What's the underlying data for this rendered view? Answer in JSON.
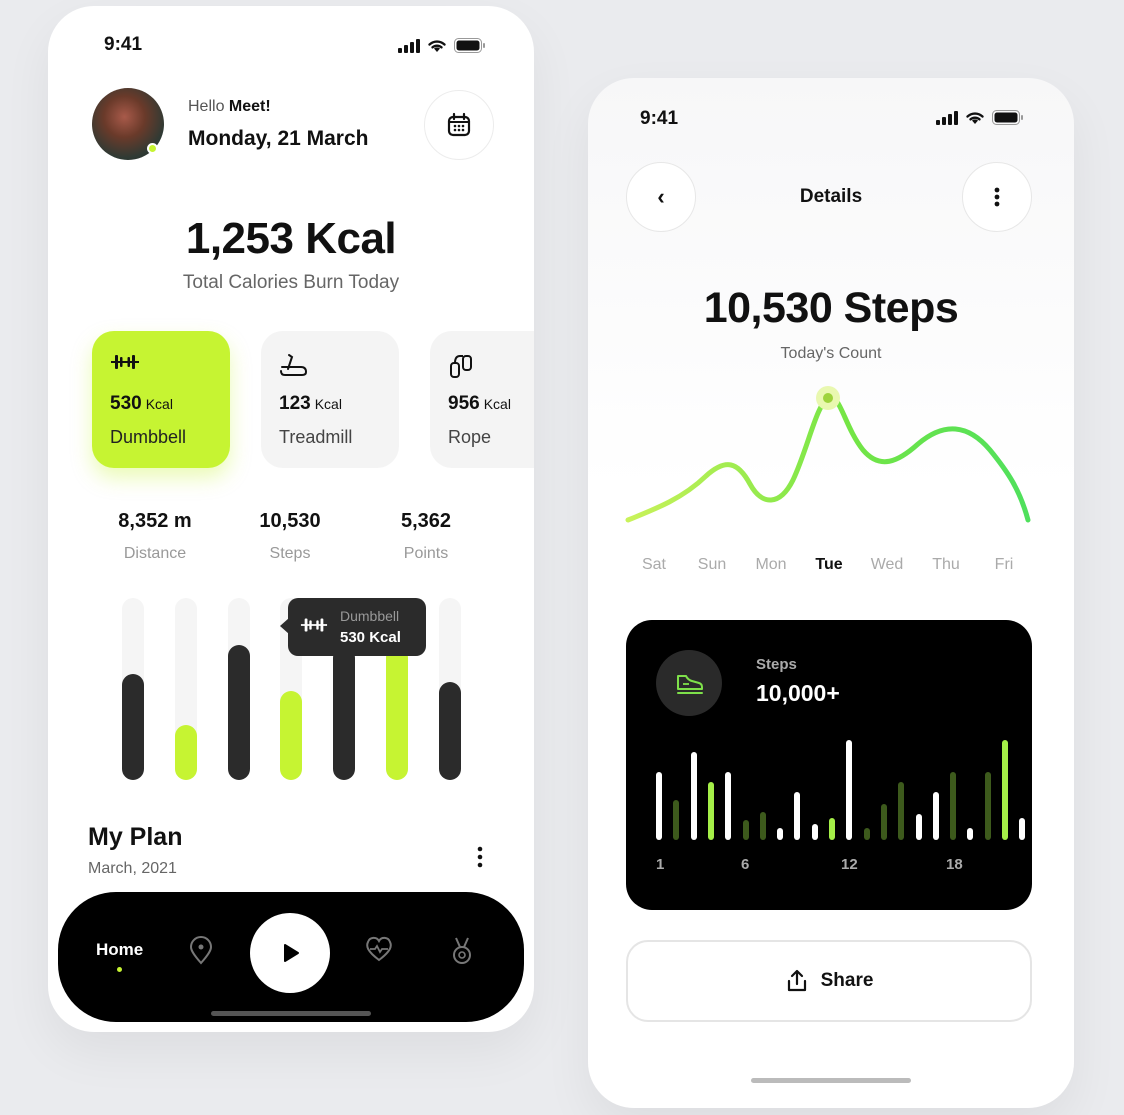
{
  "left_phone": {
    "status": {
      "time": "9:41"
    },
    "header": {
      "greeting_prefix": "Hello",
      "user_name": "Meet!",
      "date": "Monday, 21 March"
    },
    "summary": {
      "value": "1,253 Kcal",
      "label": "Total Calories Burn Today"
    },
    "activity_cards": [
      {
        "value": "530",
        "unit": "Kcal",
        "name": "Dumbbell",
        "icon": "dumbbell-icon",
        "active": true
      },
      {
        "value": "123",
        "unit": "Kcal",
        "name": "Treadmill",
        "icon": "treadmill-icon",
        "active": false
      },
      {
        "value": "956",
        "unit": "Kcal",
        "name": "Rope",
        "icon": "rope-icon",
        "active": false
      }
    ],
    "stats": [
      {
        "value": "8,352 m",
        "label": "Distance"
      },
      {
        "value": "10,530",
        "label": "Steps"
      },
      {
        "value": "5,362",
        "label": "Points"
      }
    ],
    "bars": {
      "levels": [
        0.58,
        0.3,
        0.74,
        0.49,
        0.73,
        0.73,
        0.54
      ],
      "highlighted": [
        false,
        true,
        false,
        true,
        false,
        true,
        false
      ],
      "tooltip": {
        "title": "Dumbbell",
        "value": "530 Kcal"
      }
    },
    "plan": {
      "title": "My Plan",
      "subtitle": "March, 2021"
    },
    "nav": {
      "home_label": "Home",
      "items": [
        "location-icon",
        "play-icon",
        "heart-rate-icon",
        "medal-icon"
      ]
    }
  },
  "right_phone": {
    "status": {
      "time": "9:41"
    },
    "header": {
      "title": "Details",
      "back_symbol": "‹"
    },
    "summary": {
      "value": "10,530 Steps",
      "label": "Today's Count"
    },
    "chart": {
      "days": [
        "Sat",
        "Sun",
        "Mon",
        "Tue",
        "Wed",
        "Thu",
        "Fri"
      ],
      "active_day": "Tue"
    },
    "steps_card": {
      "label": "Steps",
      "value": "10,000+",
      "ticks": [
        "1",
        "6",
        "12",
        "18"
      ]
    },
    "share": {
      "label": "Share"
    }
  },
  "colors": {
    "accent": "#c6f432",
    "dark": "#2b2b2b",
    "black": "#000000",
    "line_green": "#5ee65a"
  }
}
